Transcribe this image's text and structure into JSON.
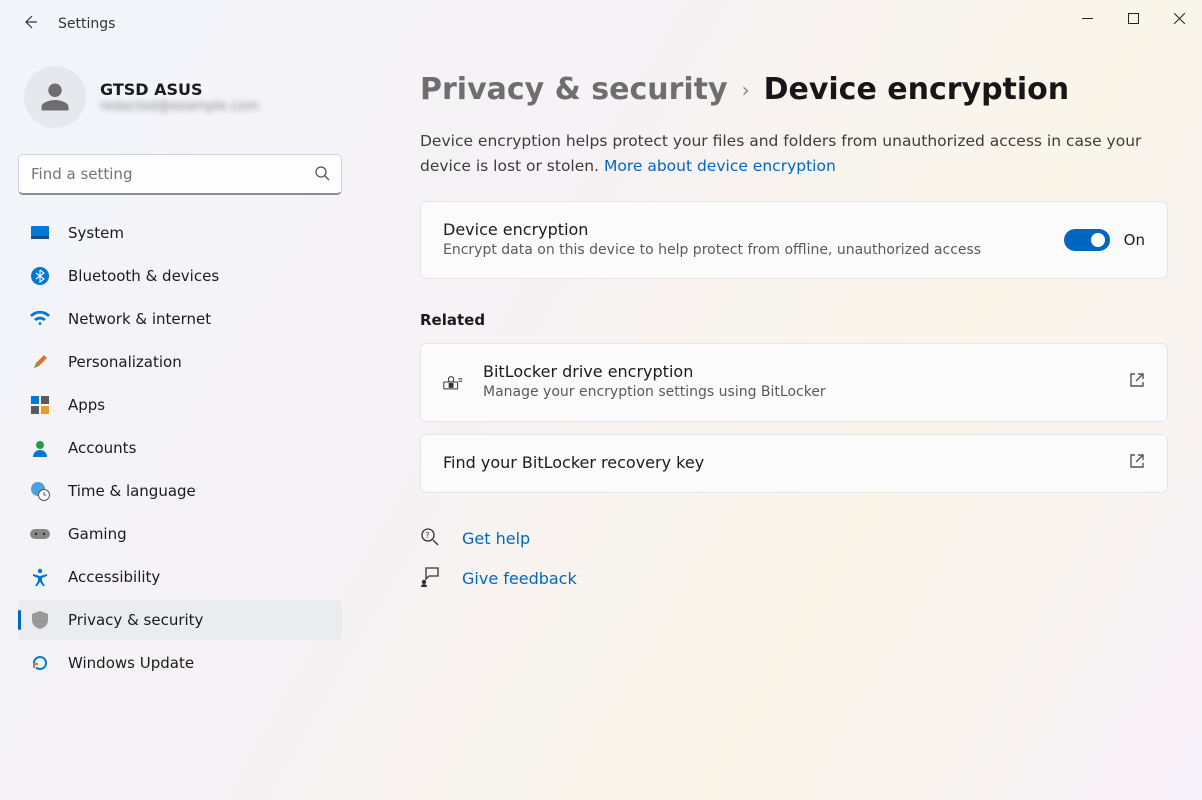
{
  "window": {
    "title": "Settings"
  },
  "user": {
    "name": "GTSD ASUS",
    "email": "redacted@example.com"
  },
  "search": {
    "placeholder": "Find a setting"
  },
  "nav": {
    "items": [
      {
        "label": "System"
      },
      {
        "label": "Bluetooth & devices"
      },
      {
        "label": "Network & internet"
      },
      {
        "label": "Personalization"
      },
      {
        "label": "Apps"
      },
      {
        "label": "Accounts"
      },
      {
        "label": "Time & language"
      },
      {
        "label": "Gaming"
      },
      {
        "label": "Accessibility"
      },
      {
        "label": "Privacy & security"
      },
      {
        "label": "Windows Update"
      }
    ]
  },
  "breadcrumb": {
    "parent": "Privacy & security",
    "current": "Device encryption"
  },
  "description": {
    "text": "Device encryption helps protect your files and folders from unauthorized access in case your device is lost or stolen. ",
    "link": "More about device encryption"
  },
  "encryption": {
    "title": "Device encryption",
    "subtitle": "Encrypt data on this device to help protect from offline, unauthorized access",
    "state": "On"
  },
  "related": {
    "label": "Related",
    "items": [
      {
        "title": "BitLocker drive encryption",
        "subtitle": "Manage your encryption settings using BitLocker"
      },
      {
        "title": "Find your BitLocker recovery key",
        "subtitle": ""
      }
    ]
  },
  "footer": {
    "help": "Get help",
    "feedback": "Give feedback"
  }
}
